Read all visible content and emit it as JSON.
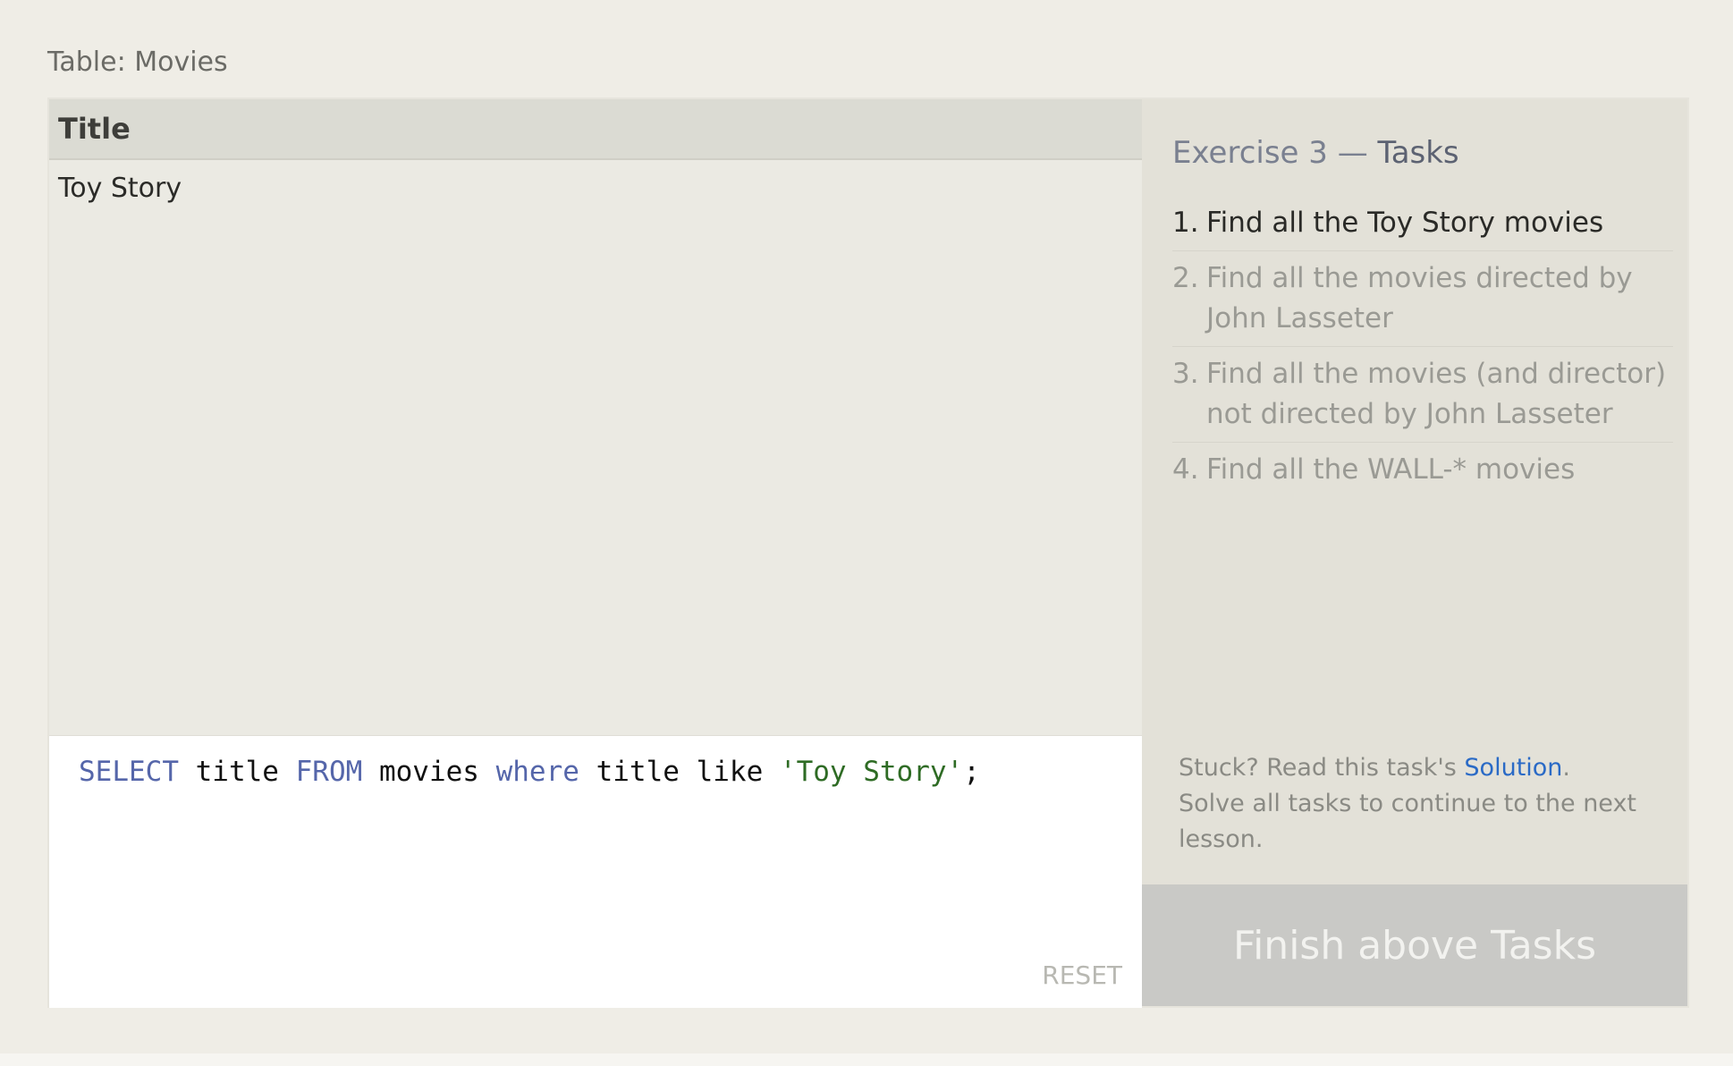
{
  "table": {
    "label": "Table: Movies",
    "columns": [
      "Title"
    ],
    "rows": [
      [
        "Toy Story"
      ]
    ]
  },
  "editor": {
    "tokens": [
      {
        "text": "SELECT",
        "type": "kw"
      },
      {
        "text": " title ",
        "type": "plain"
      },
      {
        "text": "FROM",
        "type": "kw"
      },
      {
        "text": " movies ",
        "type": "plain"
      },
      {
        "text": "where",
        "type": "kw"
      },
      {
        "text": " title like ",
        "type": "plain"
      },
      {
        "text": "'Toy Story'",
        "type": "str"
      },
      {
        "text": ";",
        "type": "plain"
      }
    ],
    "reset_label": "RESET"
  },
  "tasks": {
    "title_prefix": "Exercise 3 — ",
    "title_strong": "Tasks",
    "items": [
      {
        "num": "1.",
        "text": "Find all the Toy Story movies",
        "active": true
      },
      {
        "num": "2.",
        "text": "Find all the movies directed by John Lasseter",
        "active": false
      },
      {
        "num": "3.",
        "text": "Find all the movies (and director) not directed by John Lasseter",
        "active": false
      },
      {
        "num": "4.",
        "text": "Find all the WALL-* movies",
        "active": false
      }
    ],
    "stuck_prefix": "Stuck? Read this task's ",
    "solution_label": "Solution",
    "stuck_suffix": ".",
    "continue_text": "Solve all tasks to continue to the next lesson.",
    "finish_label": "Finish above Tasks"
  },
  "colors": {
    "keyword": "#5566aa",
    "string": "#2e6b24",
    "link": "#2a6ac6",
    "page_background": "#efede6"
  }
}
